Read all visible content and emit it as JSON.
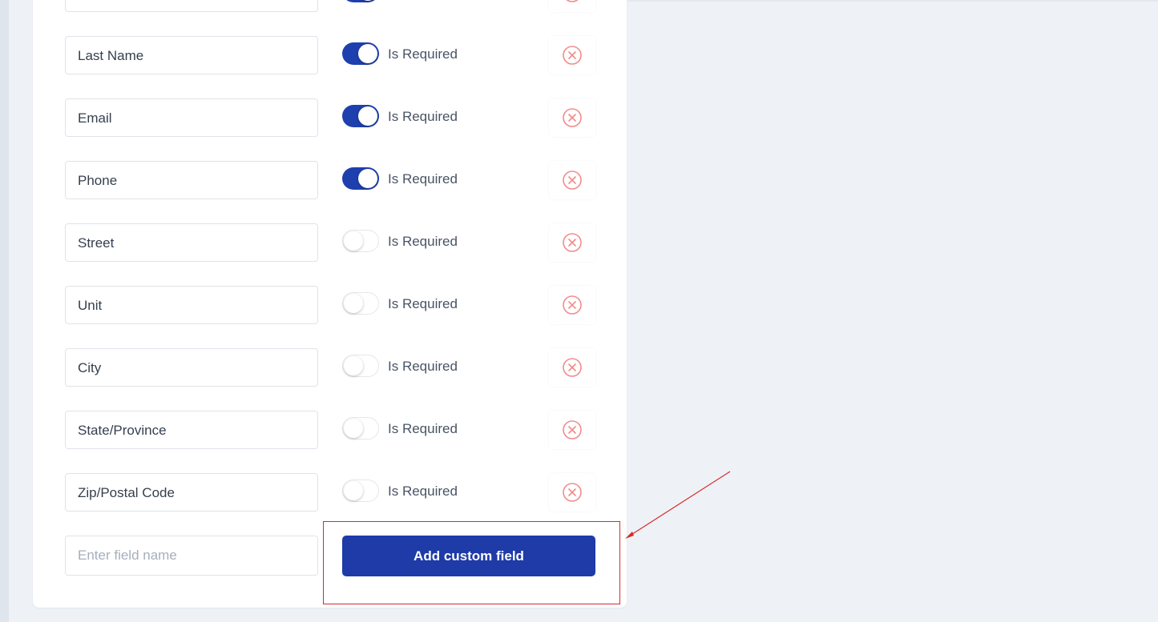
{
  "fields": [
    {
      "label": "",
      "required": true
    },
    {
      "label": "Last Name",
      "required": true
    },
    {
      "label": "Email",
      "required": true
    },
    {
      "label": "Phone",
      "required": true
    },
    {
      "label": "Street",
      "required": false
    },
    {
      "label": "Unit",
      "required": false
    },
    {
      "label": "City",
      "required": false
    },
    {
      "label": "State/Province",
      "required": false
    },
    {
      "label": "Zip/Postal Code",
      "required": false
    }
  ],
  "required_label": "Is Required",
  "new_field": {
    "placeholder": "Enter field name",
    "value": ""
  },
  "add_button_label": "Add custom field",
  "colors": {
    "accent": "#1e3ba8",
    "toggle_on": "#1e3fae",
    "remove_icon": "#f28b8b",
    "annotation": "#d62b2b",
    "background": "#eef2f7"
  },
  "icons": {
    "remove": "close-circle-icon"
  }
}
